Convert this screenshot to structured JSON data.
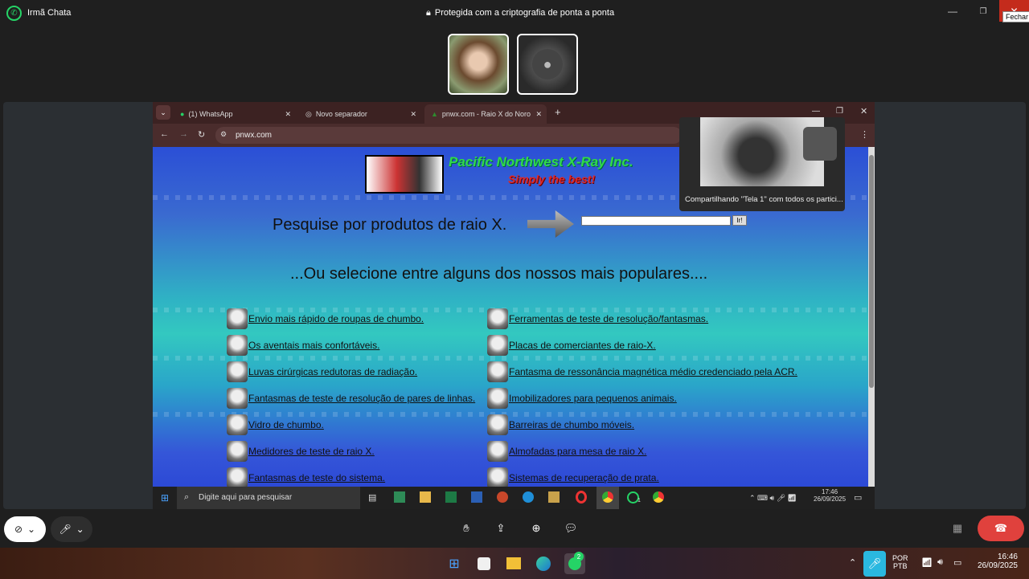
{
  "whatsapp": {
    "chat_name": "Irmã Chata",
    "encryption": "Protegida com a criptografia de ponta a ponta",
    "close_tooltip": "Fechar"
  },
  "browser": {
    "tabs": [
      {
        "label": "(1) WhatsApp"
      },
      {
        "label": "Novo separador"
      },
      {
        "label": "pnwx.com - Raio X do Noroeste"
      }
    ],
    "url": "pnwx.com"
  },
  "site": {
    "brand": "Pacific Northwest X-Ray Inc.",
    "slogan": "Simply the best!",
    "search_prompt": "Pesquise por produtos de raio X.",
    "go_button": "Ir!",
    "popular_heading": "...Ou selecione entre alguns dos nossos mais populares....",
    "left_links": [
      "Envio mais rápido de roupas de chumbo.",
      "Os aventais mais confortáveis.",
      "Luvas cirúrgicas redutoras de radiação.",
      "Fantasmas de teste de resolução de pares de linhas.",
      "Vidro de chumbo.",
      "Medidores de teste de raio X.",
      "Fantasmas de teste do sistema."
    ],
    "right_links": [
      "Ferramentas de teste de resolução/fantasmas.",
      "Placas de comerciantes de raio-X.",
      "Fantasma de ressonância magnética médio credenciado pela ACR.",
      "Imobilizadores para pequenos animais.",
      "Barreiras de chumbo móveis.",
      "Almofadas para mesa de raio X.",
      "Sistemas de recuperação de prata."
    ]
  },
  "share": {
    "notice": "Compartilhando \"Tela 1\" com todos os partici..."
  },
  "inner_taskbar": {
    "search_placeholder": "Digite aqui para pesquisar",
    "time": "17:46",
    "date": "26/09/2025",
    "wa_badge": "1"
  },
  "outer_taskbar": {
    "wa_badge": "2",
    "lang": "POR",
    "layout": "PTB",
    "time": "16:46",
    "date": "26/09/2025"
  },
  "colors": {
    "end_call": "#e0413d",
    "whatsapp_green": "#25d366"
  }
}
